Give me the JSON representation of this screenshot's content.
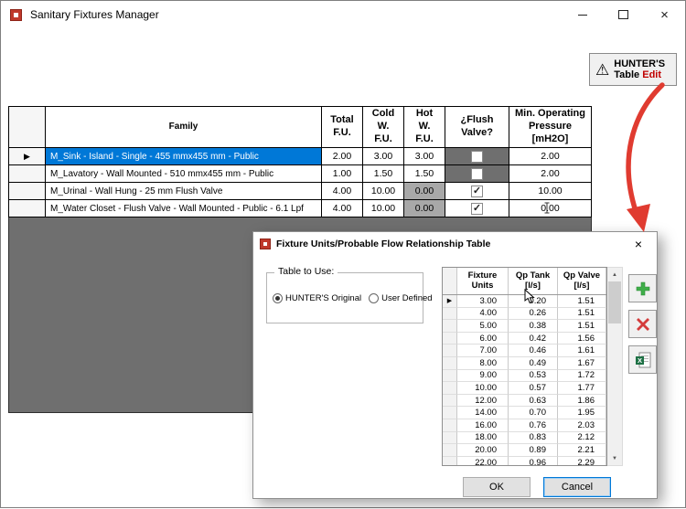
{
  "colors": {
    "accent": "#0078d7",
    "arrow": "#e03b30",
    "panel": "#6f6f6f",
    "disabled-cell": "#a8a8a8",
    "edit-red": "#c00000"
  },
  "window": {
    "title": "Sanitary Fixtures Manager",
    "minimize_icon": "",
    "maximize_icon": "",
    "close_icon": "×"
  },
  "hunters_button": {
    "warning_icon": "⚠",
    "line1": "HUNTER'S",
    "line2": "Table",
    "line2_accent": "Edit"
  },
  "main_grid": {
    "columns": [
      "Family",
      "Total\nF.U.",
      "Cold\nW.\nF.U.",
      "Hot\nW.\nF.U.",
      "¿Flush\nValve?",
      "Min. Operating\nPressure\n[mH2O]"
    ],
    "rows": [
      {
        "family": "M_Sink - Island - Single - 455 mmx455 mm - Public",
        "total": "2.00",
        "cold": "3.00",
        "hot": "3.00",
        "flush": false,
        "flush_dark": true,
        "pressure": "2.00",
        "selected": true,
        "hot_disabled": false
      },
      {
        "family": "M_Lavatory - Wall Mounted - 510 mmx455 mm - Public",
        "total": "1.00",
        "cold": "1.50",
        "hot": "1.50",
        "flush": false,
        "flush_dark": true,
        "pressure": "2.00",
        "selected": false,
        "hot_disabled": false
      },
      {
        "family": "M_Urinal - Wall Hung - 25 mm Flush Valve",
        "total": "4.00",
        "cold": "10.00",
        "hot": "0.00",
        "flush": true,
        "flush_dark": false,
        "pressure": "10.00",
        "selected": false,
        "hot_disabled": true
      },
      {
        "family": "M_Water Closet - Flush Valve - Wall Mounted - Public - 6.1 Lpf",
        "total": "4.00",
        "cold": "10.00",
        "hot": "0.00",
        "flush": true,
        "flush_dark": false,
        "pressure": "0.00",
        "selected": false,
        "hot_disabled": true
      }
    ]
  },
  "dialog": {
    "title": "Fixture Units/Probable Flow Relationship Table",
    "close_icon": "×",
    "table_to_use": {
      "label": "Table to Use:",
      "options": [
        {
          "label": "HUNTER'S Original",
          "selected": true
        },
        {
          "label": "User Defined",
          "selected": false
        }
      ]
    },
    "grid": {
      "columns": [
        "Fixture\nUnits",
        "Qp Tank\n[l/s]",
        "Qp Valve\n[l/s]"
      ],
      "rows": [
        [
          "3.00",
          "0.20",
          "1.51"
        ],
        [
          "4.00",
          "0.26",
          "1.51"
        ],
        [
          "5.00",
          "0.38",
          "1.51"
        ],
        [
          "6.00",
          "0.42",
          "1.56"
        ],
        [
          "7.00",
          "0.46",
          "1.61"
        ],
        [
          "8.00",
          "0.49",
          "1.67"
        ],
        [
          "9.00",
          "0.53",
          "1.72"
        ],
        [
          "10.00",
          "0.57",
          "1.77"
        ],
        [
          "12.00",
          "0.63",
          "1.86"
        ],
        [
          "14.00",
          "0.70",
          "1.95"
        ],
        [
          "16.00",
          "0.76",
          "2.03"
        ],
        [
          "18.00",
          "0.83",
          "2.12"
        ],
        [
          "20.00",
          "0.89",
          "2.21"
        ],
        [
          "22.00",
          "0.96",
          "2.29"
        ]
      ],
      "scroll_up_icon": "▲",
      "scroll_down_icon": "▼"
    },
    "buttons": {
      "ok": "OK",
      "cancel": "Cancel"
    }
  }
}
